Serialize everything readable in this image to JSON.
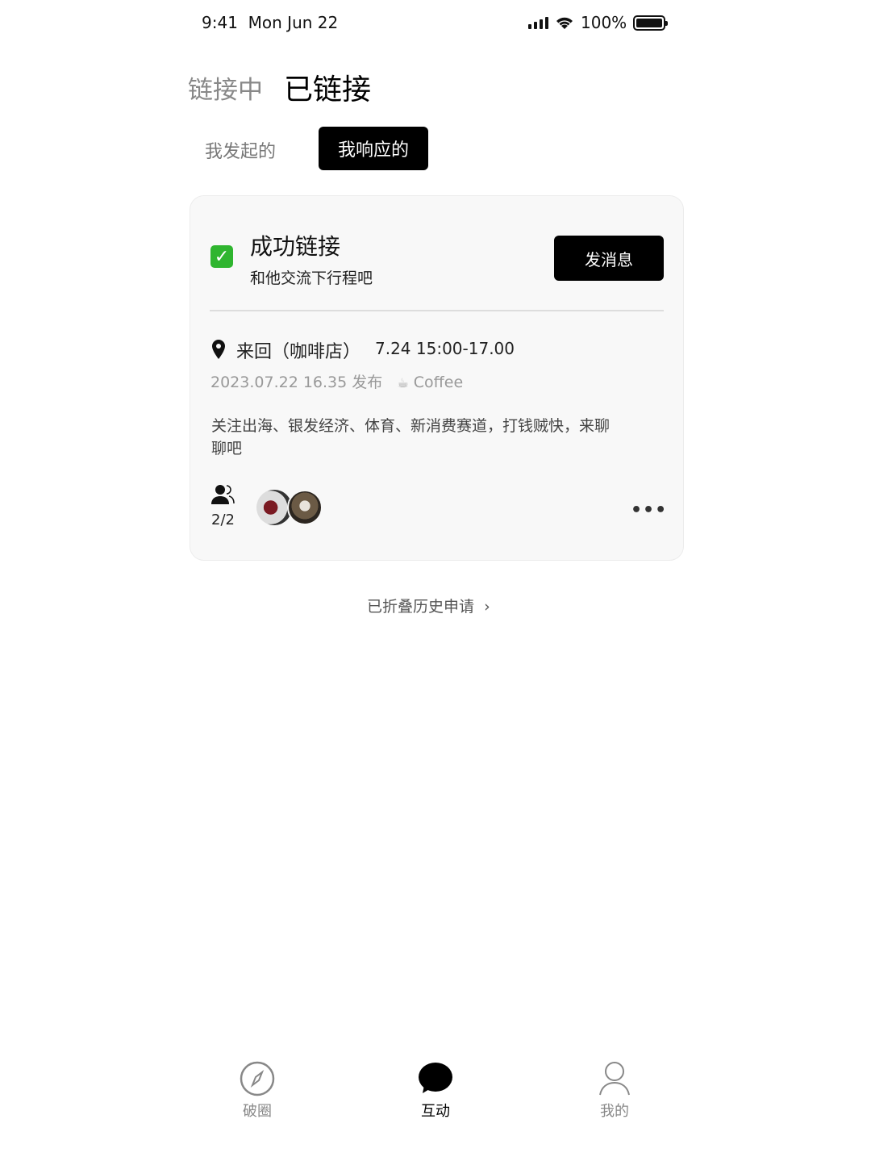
{
  "status_bar": {
    "time": "9:41",
    "date": "Mon Jun 22",
    "battery": "100%"
  },
  "top_tabs": [
    {
      "label": "链接中",
      "active": false
    },
    {
      "label": "已链接",
      "active": true
    }
  ],
  "sub_tabs": [
    {
      "label": "我发起的",
      "active": false
    },
    {
      "label": "我响应的",
      "active": true
    }
  ],
  "card": {
    "status_title": "成功链接",
    "status_sub": "和他交流下行程吧",
    "message_button": "发消息",
    "place": "来回（咖啡店）",
    "time": "7.24 15:00-17.00",
    "published": "2023.07.22 16.35 发布",
    "category_icon": "☕",
    "category": "Coffee",
    "description": "关注出海、银发经济、体育、新消费赛道，打钱贼快，来聊聊吧",
    "participants": "2/2"
  },
  "history_link": "已折叠历史申请",
  "bottom_nav": [
    {
      "label": "破圈",
      "active": false
    },
    {
      "label": "互动",
      "active": true
    },
    {
      "label": "我的",
      "active": false
    }
  ],
  "colors": {
    "accent": "#000000",
    "check": "#2fb52f",
    "muted": "#888888"
  }
}
